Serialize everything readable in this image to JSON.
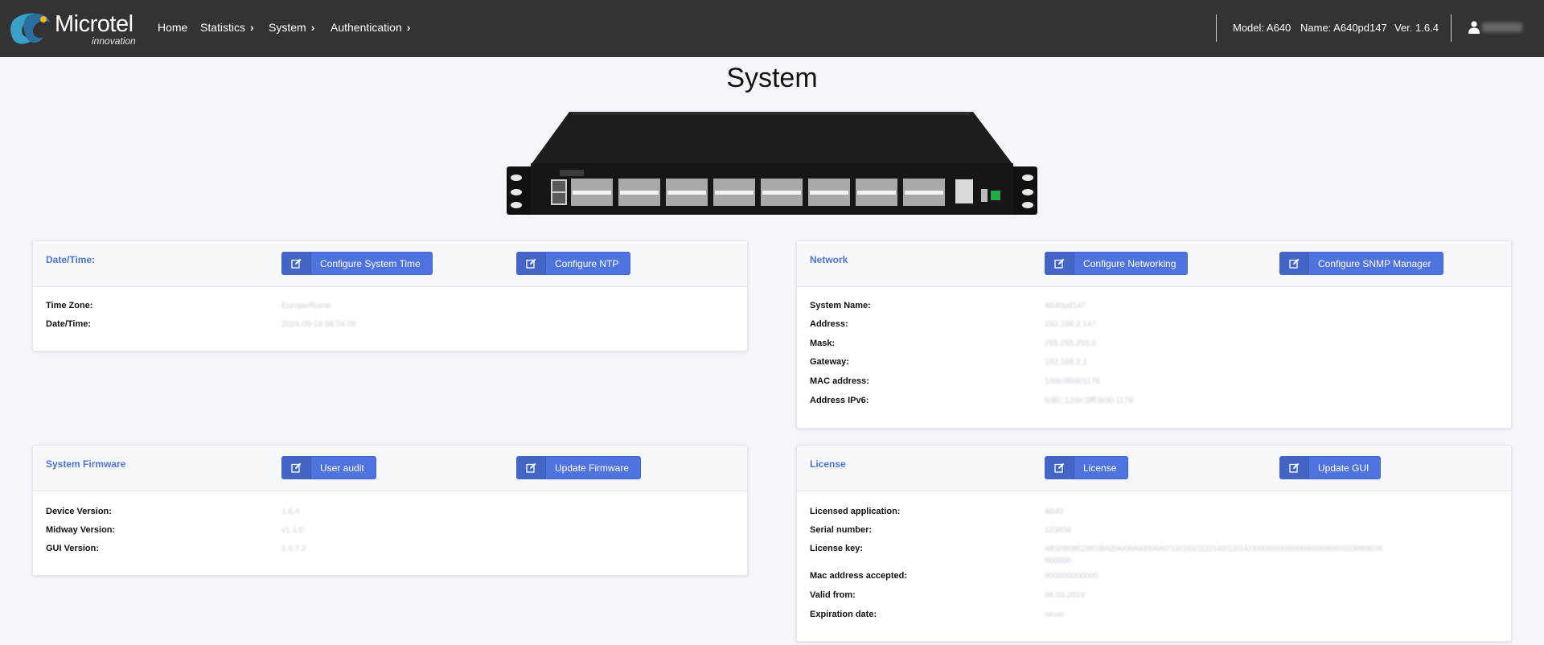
{
  "nav": {
    "brand_name": "Microtel",
    "brand_sub": "innovation",
    "home": "Home",
    "statistics": "Statistics",
    "system": "System",
    "authentication": "Authentication",
    "model": "Model: A640",
    "name": "Name: A640pd147",
    "version": "Ver. 1.6.4"
  },
  "page": {
    "title": "System"
  },
  "datetime": {
    "title": "Date/Time:",
    "btn1": "Configure System Time",
    "btn2": "Configure NTP",
    "rows": [
      {
        "label": "Time Zone:",
        "value": "Europe/Rome"
      },
      {
        "label": "Date/Time:",
        "value": "2024-09-18 08:04:05"
      }
    ]
  },
  "network": {
    "title": "Network",
    "btn1": "Configure Networking",
    "btn2": "Configure SNMP Manager",
    "rows": [
      {
        "label": "System Name:",
        "value": "A640pd147"
      },
      {
        "label": "Address:",
        "value": "192.168.2.147"
      },
      {
        "label": "Mask:",
        "value": "255.255.255.0"
      },
      {
        "label": "Gateway:",
        "value": "192.168.2.1"
      },
      {
        "label": "MAC address:",
        "value": "10de3f6001178"
      },
      {
        "label": "Address IPv6:",
        "value": "fe80::12de:3fff:fe00:1178"
      }
    ]
  },
  "firmware": {
    "title": "System Firmware",
    "btn1": "User audit",
    "btn2": "Update Firmware",
    "rows": [
      {
        "label": "Device Version:",
        "value": "1.6.4"
      },
      {
        "label": "Midway Version:",
        "value": "v1.1.0"
      },
      {
        "label": "GUI Version:",
        "value": "1.0.7.2"
      }
    ]
  },
  "license": {
    "title": "License",
    "btn1": "License",
    "btn2": "Update GUI",
    "rows": [
      {
        "label": "Licensed application:",
        "value": "A640"
      },
      {
        "label": "Serial number:",
        "value": "123456"
      },
      {
        "label": "License key:",
        "value": "A8020808E23802BA20A430A4300AA071201502112214201201423000000000000000000000002230808100",
        "value2": "000000"
      },
      {
        "label": "Mac address accepted:",
        "value": "000000000000"
      },
      {
        "label": "Valid from:",
        "value": "08.03.2024"
      },
      {
        "label": "Expiration date:",
        "value": "never"
      }
    ]
  }
}
